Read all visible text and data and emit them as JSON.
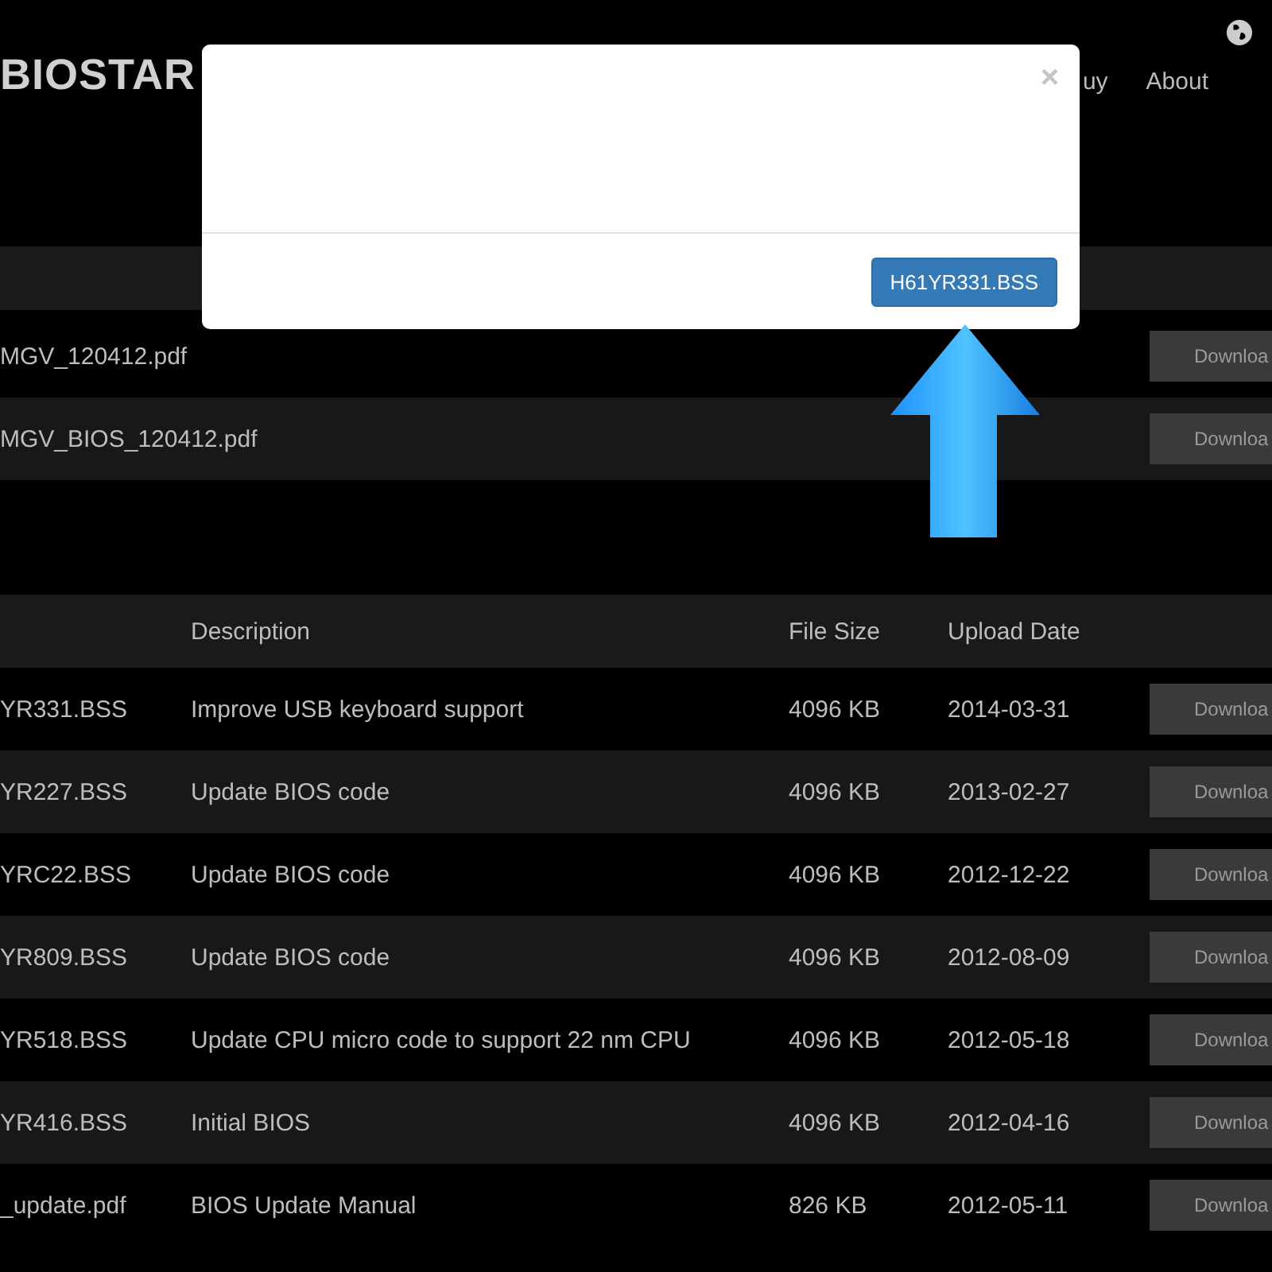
{
  "header": {
    "logo": "BIOSTAR",
    "nav": [
      "uy",
      "About"
    ]
  },
  "manuals": [
    {
      "file": "MGV_120412.pdf",
      "button": "Downloa"
    },
    {
      "file": "MGV_BIOS_120412.pdf",
      "button": "Downloa"
    }
  ],
  "bios_table": {
    "columns": [
      "Description",
      "File Size",
      "Upload Date"
    ],
    "rows": [
      {
        "file": "YR331.BSS",
        "description": "Improve USB keyboard support",
        "size": "4096 KB",
        "date": "2014-03-31",
        "button": "Downloa"
      },
      {
        "file": "YR227.BSS",
        "description": "Update BIOS code",
        "size": "4096 KB",
        "date": "2013-02-27",
        "button": "Downloa"
      },
      {
        "file": "YRC22.BSS",
        "description": "Update BIOS code",
        "size": "4096 KB",
        "date": "2012-12-22",
        "button": "Downloa"
      },
      {
        "file": "YR809.BSS",
        "description": "Update BIOS code",
        "size": "4096 KB",
        "date": "2012-08-09",
        "button": "Downloa"
      },
      {
        "file": "YR518.BSS",
        "description": "Update CPU micro code to support 22 nm CPU",
        "size": "4096 KB",
        "date": "2012-05-18",
        "button": "Downloa"
      },
      {
        "file": "YR416.BSS",
        "description": "Initial BIOS",
        "size": "4096 KB",
        "date": "2012-04-16",
        "button": "Downloa"
      },
      {
        "file": "_update.pdf",
        "description": "BIOS Update Manual",
        "size": "826 KB",
        "date": "2012-05-11",
        "button": "Downloa"
      }
    ]
  },
  "modal": {
    "close": "×",
    "button": "H61YR331.BSS"
  }
}
